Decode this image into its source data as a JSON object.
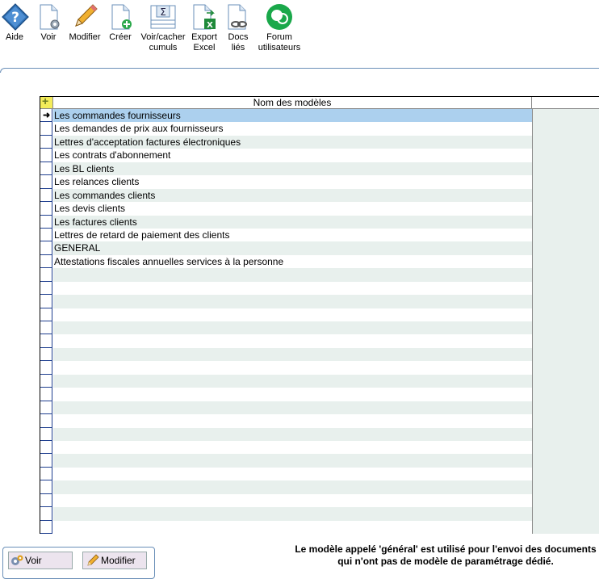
{
  "toolbar": {
    "aide": "Aide",
    "voir": "Voir",
    "modifier": "Modifier",
    "creer": "Créer",
    "voir_cacher_cumuls": "Voir/cacher\ncumuls",
    "export_excel": "Export\nExcel",
    "docs_lies": "Docs\nliés",
    "forum": "Forum\nutilisateurs"
  },
  "grid": {
    "header": "Nom des modèles",
    "corner_symbol": "+",
    "rows": [
      "Les commandes fournisseurs",
      "Les demandes de prix aux fournisseurs",
      "Lettres d'acceptation factures électroniques",
      "Les contrats d'abonnement",
      "Les BL clients",
      "Les relances clients",
      "Les commandes clients",
      "Les devis clients",
      "Les factures clients",
      "Lettres de retard de paiement des clients",
      "GENERAL",
      "Attestations fiscales annuelles services à la personne"
    ],
    "selected_index": 0,
    "total_rows": 32
  },
  "bottom": {
    "voir": "Voir",
    "modifier": "Modifier",
    "note_line1": "Le modèle appelé 'général' est utilisé pour l'envoi des documents",
    "note_line2": "qui n'ont pas de modèle de paramétrage dédié."
  },
  "colors": {
    "selected_row": "#acd0ee",
    "alt_row": "#e8f0ed",
    "forum_green": "#1aa84a"
  }
}
